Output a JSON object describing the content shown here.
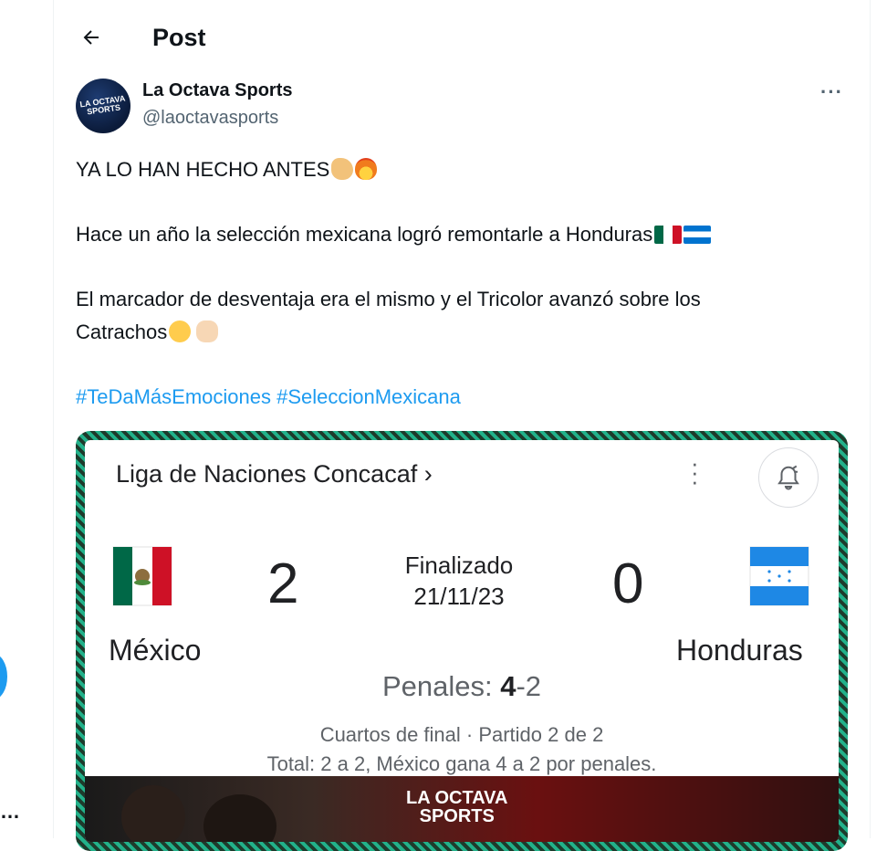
{
  "header": {
    "title": "Post"
  },
  "author": {
    "name": "La Octava Sports",
    "handle": "@laoctavasports",
    "avatar_text": "LA OCTAVA SPORTS"
  },
  "tweet": {
    "line1": "YA LO HAN HECHO ANTES",
    "line2": "Hace un año la selección mexicana logró remontarle a Honduras",
    "line3a": "El marcador de desventaja era el mismo y el Tricolor avanzó sobre los",
    "line3b": "Catrachos",
    "hashtags": [
      "#TeDaMásEmociones",
      "#SeleccionMexicana"
    ]
  },
  "match": {
    "league": "Liga de Naciones Concacaf ›",
    "home_team": "México",
    "away_team": "Honduras",
    "home_score": "2",
    "away_score": "0",
    "status": "Finalizado",
    "date": "21/11/23",
    "penalties_label": "Penales:",
    "penalties_home": "4",
    "penalties_sep": "-",
    "penalties_away": "2",
    "round": "Cuartos de final · Partido 2 de 2",
    "total": "Total: 2 a 2, México gana 4 a 2 por penales.",
    "watermark": "LA OCTAVA SPORTS"
  },
  "icons": {
    "back": "arrow-left-icon",
    "more": "more-horizontal-icon",
    "menu": "more-vertical-icon",
    "bell": "bell-add-icon",
    "emojis": [
      "flexed-biceps",
      "fire",
      "flag-mexico",
      "flag-honduras",
      "star-struck",
      "oncoming-fist"
    ]
  },
  "colors": {
    "link": "#1d9bf0",
    "text": "#0f1419",
    "secondary": "#536471",
    "border_pattern": "#22b18a"
  }
}
